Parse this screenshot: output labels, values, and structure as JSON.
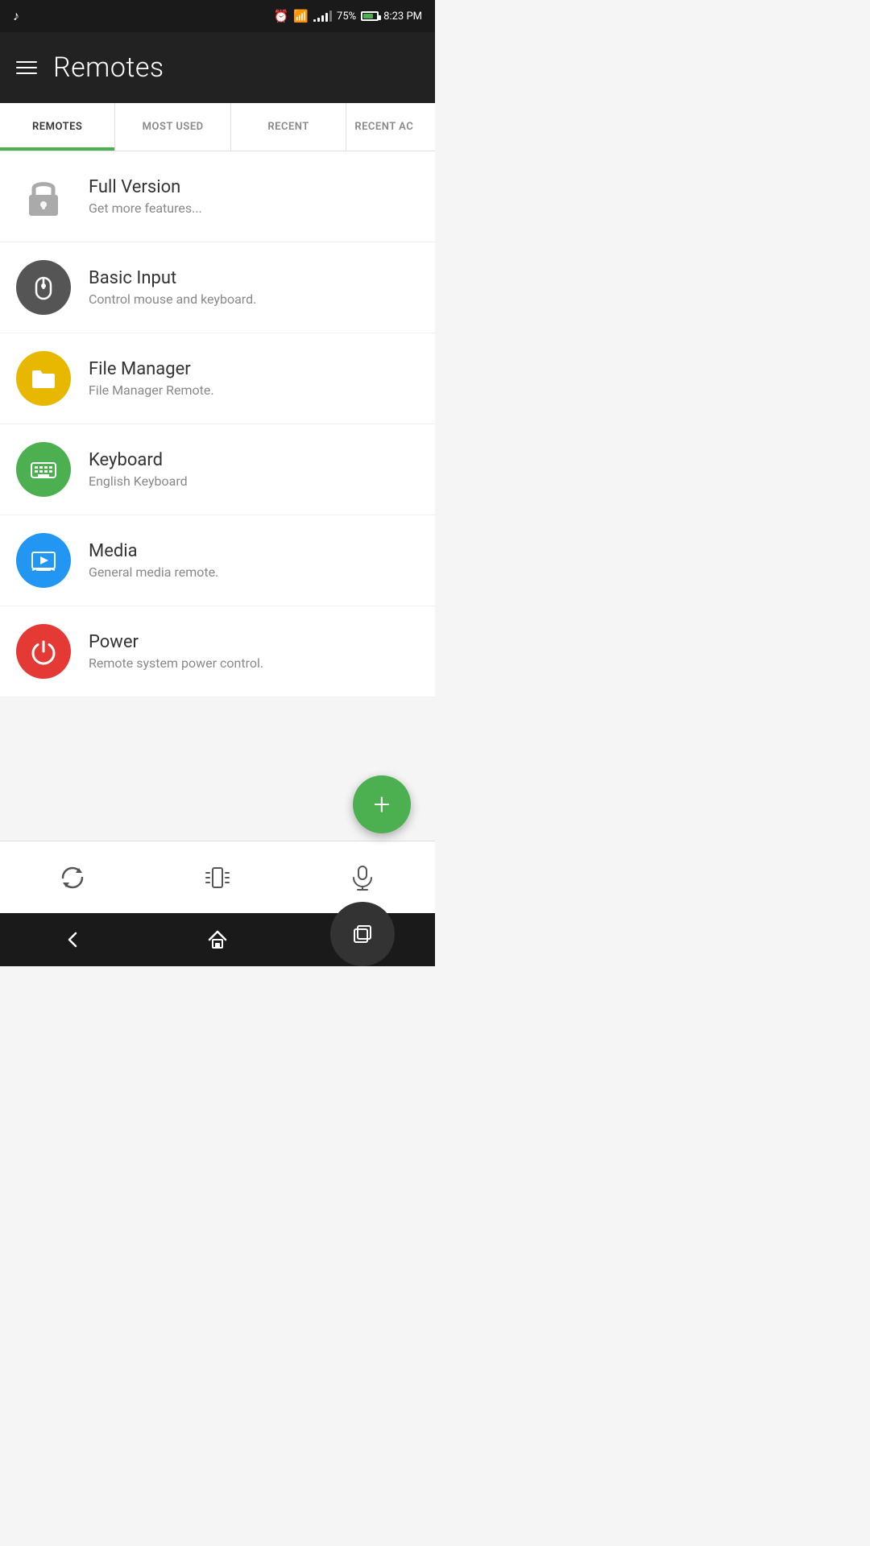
{
  "statusBar": {
    "time": "8:23 PM",
    "battery": "75%",
    "musicNote": "♪"
  },
  "header": {
    "title": "Remotes"
  },
  "tabs": [
    {
      "id": "remotes",
      "label": "REMOTES",
      "active": true
    },
    {
      "id": "most-used",
      "label": "MOST USED",
      "active": false
    },
    {
      "id": "recent",
      "label": "RECENT",
      "active": false
    },
    {
      "id": "recent-ac",
      "label": "RECENT AC",
      "active": false,
      "partial": true
    }
  ],
  "remoteItems": [
    {
      "id": "full-version",
      "title": "Full Version",
      "subtitle": "Get more features...",
      "iconType": "lock",
      "iconColor": "#888"
    },
    {
      "id": "basic-input",
      "title": "Basic Input",
      "subtitle": "Control mouse and keyboard.",
      "iconType": "mouse",
      "iconColor": "#555",
      "iconBg": "#555"
    },
    {
      "id": "file-manager",
      "title": "File Manager",
      "subtitle": "File Manager Remote.",
      "iconType": "folder",
      "iconBg": "#e8b800"
    },
    {
      "id": "keyboard",
      "title": "Keyboard",
      "subtitle": "English Keyboard",
      "iconType": "keyboard",
      "iconBg": "#4caf50"
    },
    {
      "id": "media",
      "title": "Media",
      "subtitle": "General media remote.",
      "iconType": "play",
      "iconBg": "#2196f3"
    },
    {
      "id": "power",
      "title": "Power",
      "subtitle": "Remote system power control.",
      "iconType": "power",
      "iconBg": "#e53935"
    }
  ],
  "fab": {
    "label": "+"
  },
  "bottomToolbar": {
    "refresh": "↻",
    "vibrate": "📳",
    "mic": "🎤"
  },
  "navBar": {
    "back": "←",
    "home": "⌂",
    "recents": "▣"
  }
}
